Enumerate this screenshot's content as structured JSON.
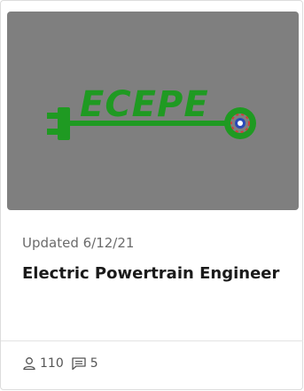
{
  "card": {
    "logo": {
      "icon": "ecepe-logo",
      "text": "ECEPE",
      "color": "#1f9a22"
    },
    "updated": "Updated 6/12/21",
    "title": "Electric Powertrain Engineer",
    "stats": {
      "members_icon": "person-icon",
      "members": "110",
      "comments_icon": "comment-icon",
      "comments": "5"
    }
  }
}
